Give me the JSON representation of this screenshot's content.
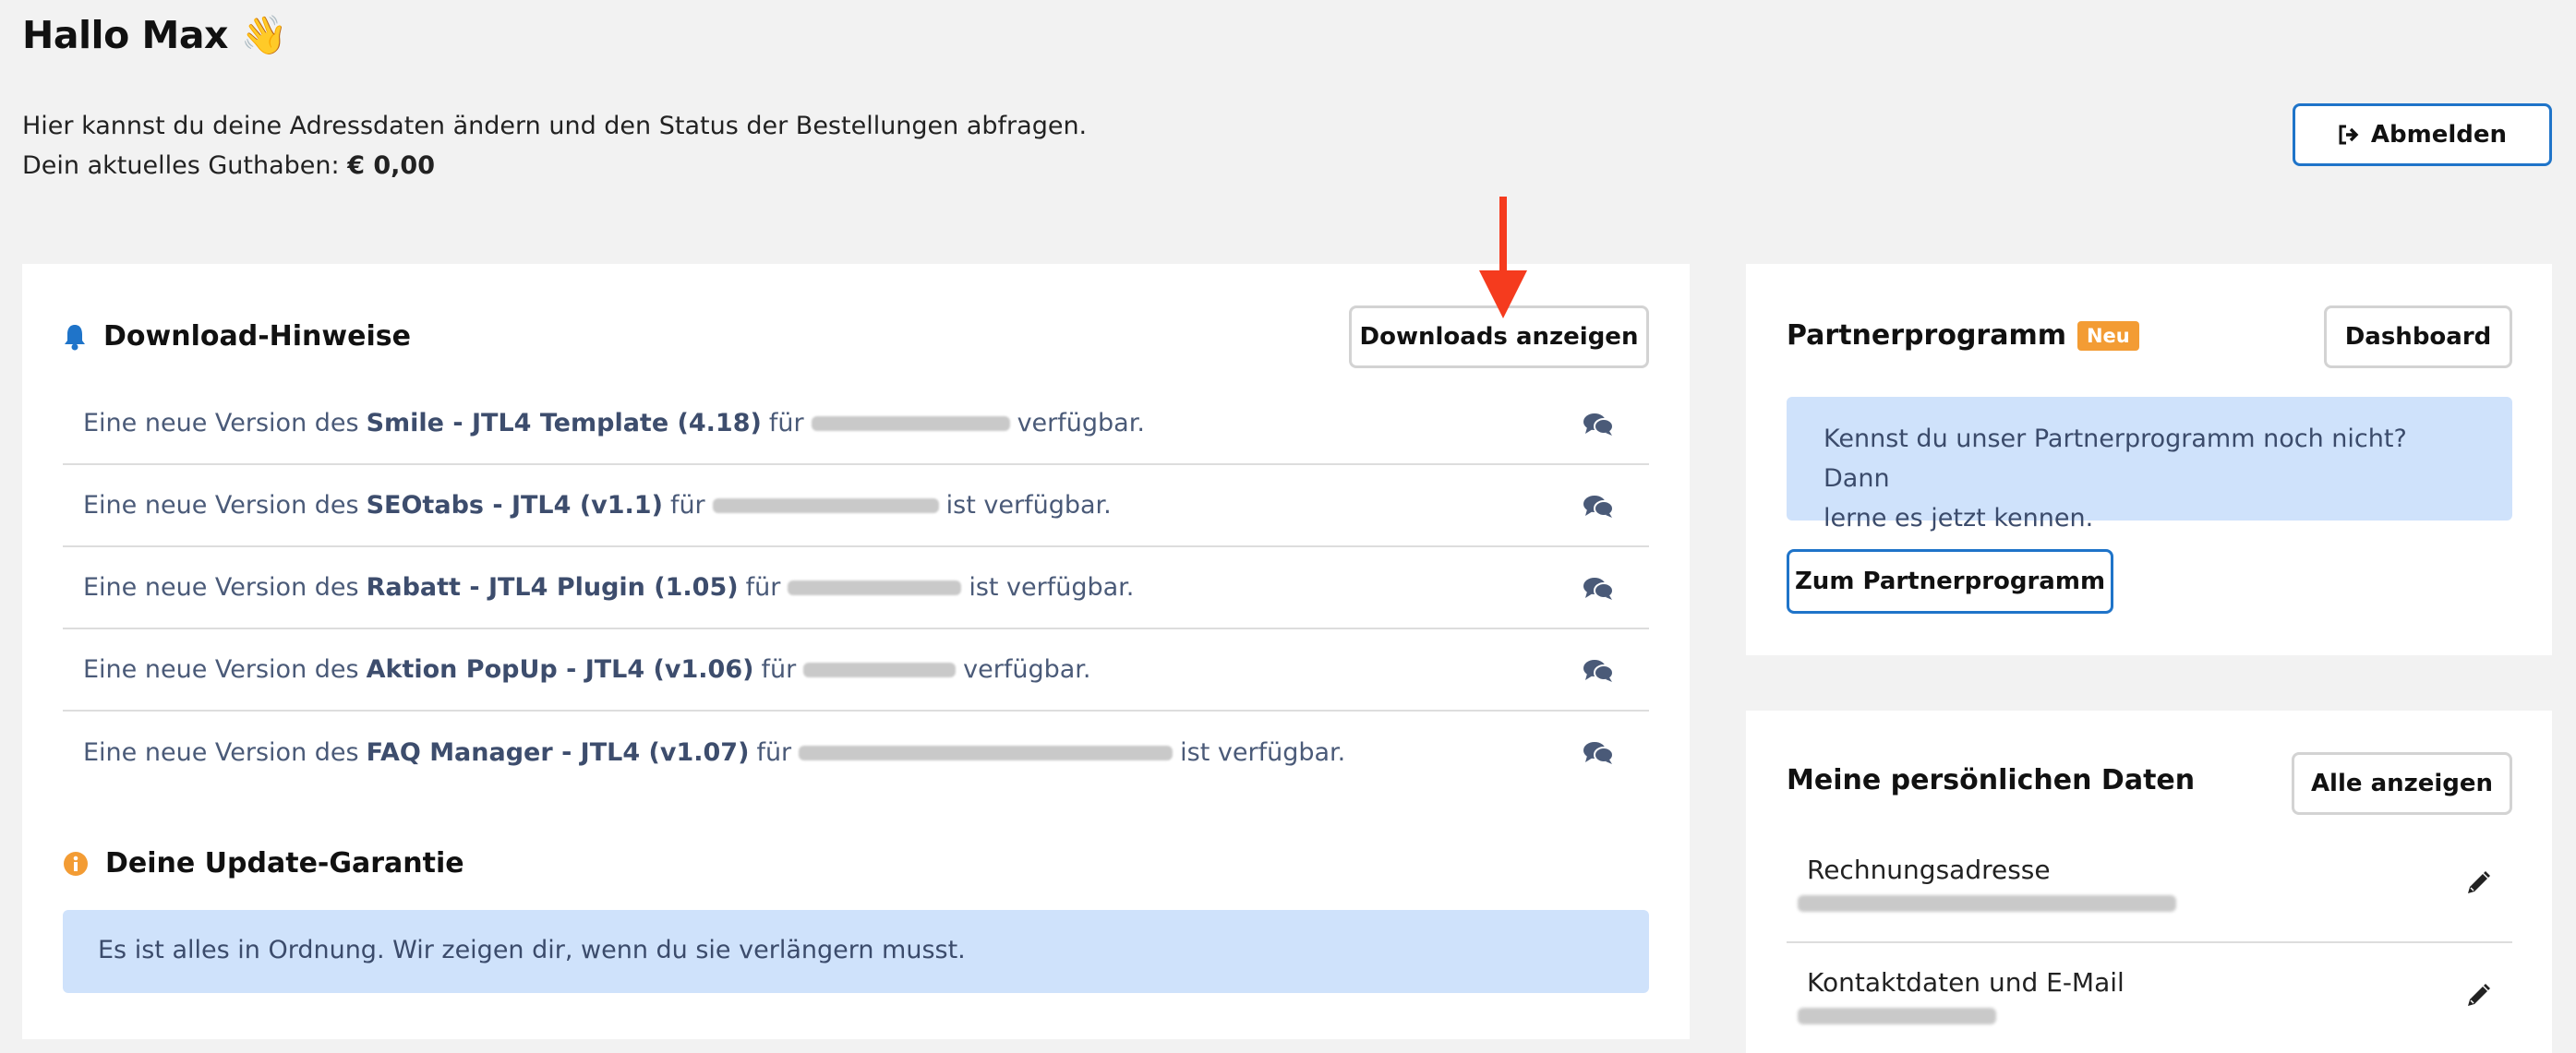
{
  "header": {
    "title": "Hallo Max 👋",
    "intro_line1": "Hier kannst du deine Adressdaten ändern und den Status der Bestellungen abfragen.",
    "balance_label": "Dein aktuelles Guthaben:",
    "balance_value": "€ 0,00",
    "logout_label": "Abmelden"
  },
  "downloads": {
    "heading": "Download-Hinweise",
    "show_button": "Downloads anzeigen",
    "items": [
      {
        "prefix": "Eine neue Version des",
        "product": "Smile - JTL4 Template (4.18)",
        "for": "für",
        "suffix": "verfügbar."
      },
      {
        "prefix": "Eine neue Version des",
        "product": "SEOtabs - JTL4 (v1.1)",
        "for": "für",
        "suffix": "ist verfügbar."
      },
      {
        "prefix": "Eine neue Version des",
        "product": "Rabatt - JTL4 Plugin (1.05)",
        "for": "für",
        "suffix": "ist verfügbar."
      },
      {
        "prefix": "Eine neue Version des",
        "product": "Aktion PopUp - JTL4 (v1.06)",
        "for": "für",
        "suffix": "verfügbar."
      },
      {
        "prefix": "Eine neue Version des",
        "product": "FAQ Manager - JTL4 (v1.07)",
        "for": "für",
        "suffix": "ist verfügbar."
      }
    ]
  },
  "guarantee": {
    "heading": "Deine Update-Garantie",
    "message": "Es ist alles in Ordnung. Wir zeigen dir, wenn du sie verlängern musst."
  },
  "partner": {
    "heading": "Partnerprogramm",
    "badge": "Neu",
    "dashboard_button": "Dashboard",
    "info_line1": "Kennst du unser Partnerprogramm noch nicht? Dann",
    "info_line2": "lerne es jetzt kennen.",
    "cta_button": "Zum Partnerprogramm"
  },
  "personal": {
    "heading": "Meine persönlichen Daten",
    "show_all_button": "Alle anzeigen",
    "rows": [
      {
        "label": "Rechnungsadresse"
      },
      {
        "label": "Kontaktdaten und E-Mail"
      }
    ]
  },
  "colors": {
    "primary": "#1f74c9",
    "info_bg": "#cfe2fb",
    "badge": "#f39c34",
    "annotation_arrow": "#f53b1e"
  }
}
